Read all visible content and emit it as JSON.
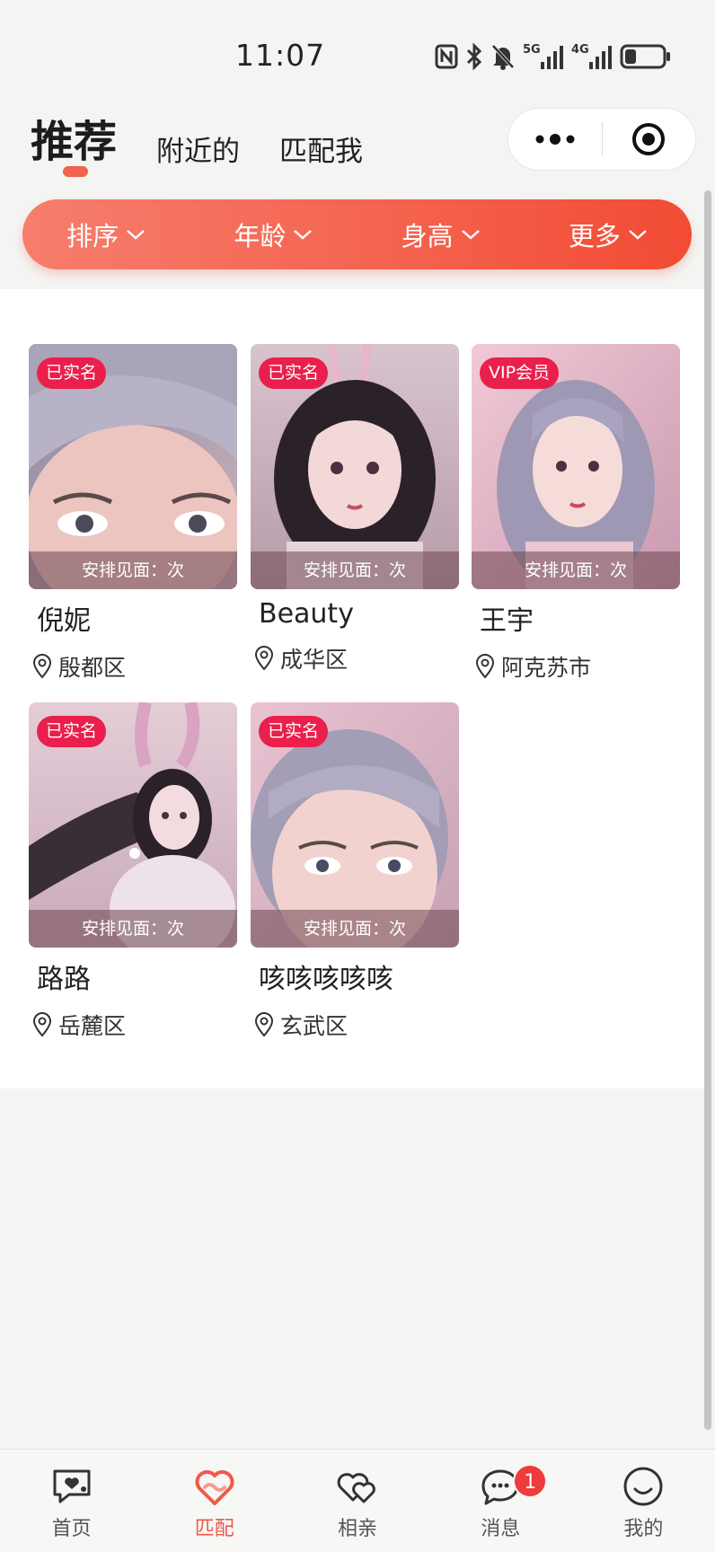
{
  "status_bar": {
    "time": "11:07"
  },
  "tabs": [
    {
      "label": "推荐",
      "active": true
    },
    {
      "label": "附近的",
      "active": false
    },
    {
      "label": "匹配我",
      "active": false
    }
  ],
  "filters": [
    {
      "label": "排序"
    },
    {
      "label": "年龄"
    },
    {
      "label": "身高"
    },
    {
      "label": "更多"
    }
  ],
  "colors": {
    "accent": "#f0634c",
    "badge": "#ea1f4b",
    "nav_active": "#ef5a4a"
  },
  "cards": [
    {
      "badge": "已实名",
      "meet": "安排见面：次",
      "name": "倪妮",
      "location": "殷都区"
    },
    {
      "badge": "已实名",
      "meet": "安排见面：次",
      "name": "Beauty",
      "location": "成华区"
    },
    {
      "badge": "VIP会员",
      "meet": "安排见面：次",
      "name": "王宇",
      "location": "阿克苏市"
    },
    {
      "badge": "已实名",
      "meet": "安排见面：次",
      "name": "路路",
      "location": "岳麓区"
    },
    {
      "badge": "已实名",
      "meet": "安排见面：次",
      "name": "咳咳咳咳咳",
      "location": "玄武区"
    }
  ],
  "bottom_nav": [
    {
      "label": "首页",
      "icon": "home-chat-icon",
      "active": false
    },
    {
      "label": "匹配",
      "icon": "match-heart-icon",
      "active": true
    },
    {
      "label": "相亲",
      "icon": "double-heart-icon",
      "active": false
    },
    {
      "label": "消息",
      "icon": "message-icon",
      "active": false,
      "badge": "1"
    },
    {
      "label": "我的",
      "icon": "smile-icon",
      "active": false
    }
  ]
}
